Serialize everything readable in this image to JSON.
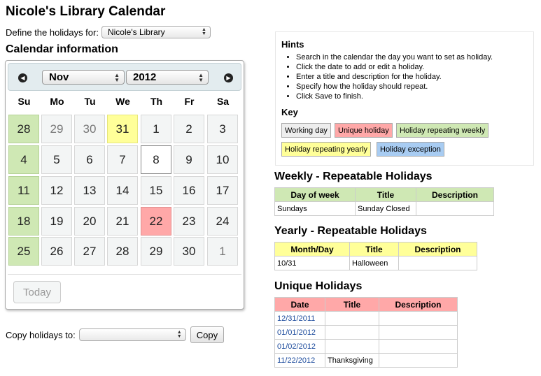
{
  "page": {
    "title": "Nicole's Library Calendar",
    "define_label": "Define the holidays for:",
    "library_select": "Nicole's Library",
    "calendar_heading": "Calendar information"
  },
  "calendar": {
    "month": "Nov",
    "year": "2012",
    "prev_icon": "arrow-left-icon",
    "next_icon": "arrow-right-icon",
    "weekdays": [
      "Su",
      "Mo",
      "Tu",
      "We",
      "Th",
      "Fr",
      "Sa"
    ],
    "weeks": [
      [
        {
          "d": "28",
          "type": "weekly"
        },
        {
          "d": "29",
          "type": "other"
        },
        {
          "d": "30",
          "type": "other"
        },
        {
          "d": "31",
          "type": "yearly"
        },
        {
          "d": "1",
          "type": "normal"
        },
        {
          "d": "2",
          "type": "normal"
        },
        {
          "d": "3",
          "type": "normal"
        }
      ],
      [
        {
          "d": "4",
          "type": "weekly"
        },
        {
          "d": "5",
          "type": "normal"
        },
        {
          "d": "6",
          "type": "normal"
        },
        {
          "d": "7",
          "type": "normal"
        },
        {
          "d": "8",
          "type": "today"
        },
        {
          "d": "9",
          "type": "normal"
        },
        {
          "d": "10",
          "type": "normal"
        }
      ],
      [
        {
          "d": "11",
          "type": "weekly"
        },
        {
          "d": "12",
          "type": "normal"
        },
        {
          "d": "13",
          "type": "normal"
        },
        {
          "d": "14",
          "type": "normal"
        },
        {
          "d": "15",
          "type": "normal"
        },
        {
          "d": "16",
          "type": "normal"
        },
        {
          "d": "17",
          "type": "normal"
        }
      ],
      [
        {
          "d": "18",
          "type": "weekly"
        },
        {
          "d": "19",
          "type": "normal"
        },
        {
          "d": "20",
          "type": "normal"
        },
        {
          "d": "21",
          "type": "normal"
        },
        {
          "d": "22",
          "type": "unique"
        },
        {
          "d": "23",
          "type": "normal"
        },
        {
          "d": "24",
          "type": "normal"
        }
      ],
      [
        {
          "d": "25",
          "type": "weekly"
        },
        {
          "d": "26",
          "type": "normal"
        },
        {
          "d": "27",
          "type": "normal"
        },
        {
          "d": "28",
          "type": "normal"
        },
        {
          "d": "29",
          "type": "normal"
        },
        {
          "d": "30",
          "type": "normal"
        },
        {
          "d": "1",
          "type": "other"
        }
      ]
    ],
    "today_button": "Today"
  },
  "copy": {
    "label": "Copy holidays to:",
    "select_value": "",
    "button": "Copy"
  },
  "hints": {
    "title": "Hints",
    "items": [
      "Search in the calendar the day you want to set as holiday.",
      "Click the date to add or edit a holiday.",
      "Enter a title and description for the holiday.",
      "Specify how the holiday should repeat.",
      "Click Save to finish."
    ],
    "key_title": "Key",
    "key": {
      "working": "Working day",
      "unique": "Unique holiday",
      "weekly": "Holiday repeating weekly",
      "yearly": "Holiday repeating yearly",
      "exception": "Holiday exception"
    }
  },
  "weekly": {
    "heading": "Weekly - Repeatable Holidays",
    "headers": [
      "Day of week",
      "Title",
      "Description"
    ],
    "rows": [
      [
        "Sundays",
        "Sunday Closed",
        ""
      ]
    ]
  },
  "yearly": {
    "heading": "Yearly - Repeatable Holidays",
    "headers": [
      "Month/Day",
      "Title",
      "Description"
    ],
    "rows": [
      [
        "10/31",
        "Halloween",
        ""
      ]
    ]
  },
  "unique": {
    "heading": "Unique Holidays",
    "headers": [
      "Date",
      "Title",
      "Description"
    ],
    "rows": [
      [
        "12/31/2011",
        "",
        ""
      ],
      [
        "01/01/2012",
        "",
        ""
      ],
      [
        "01/02/2012",
        "",
        ""
      ],
      [
        "11/22/2012",
        "Thanksgiving",
        ""
      ]
    ]
  },
  "colors": {
    "weekly": "#cfe8b4",
    "yearly": "#ffff99",
    "unique": "#ffa8a8",
    "exception": "#a8ccf2",
    "working": "#eeeeee",
    "link": "#1b4a9c"
  }
}
